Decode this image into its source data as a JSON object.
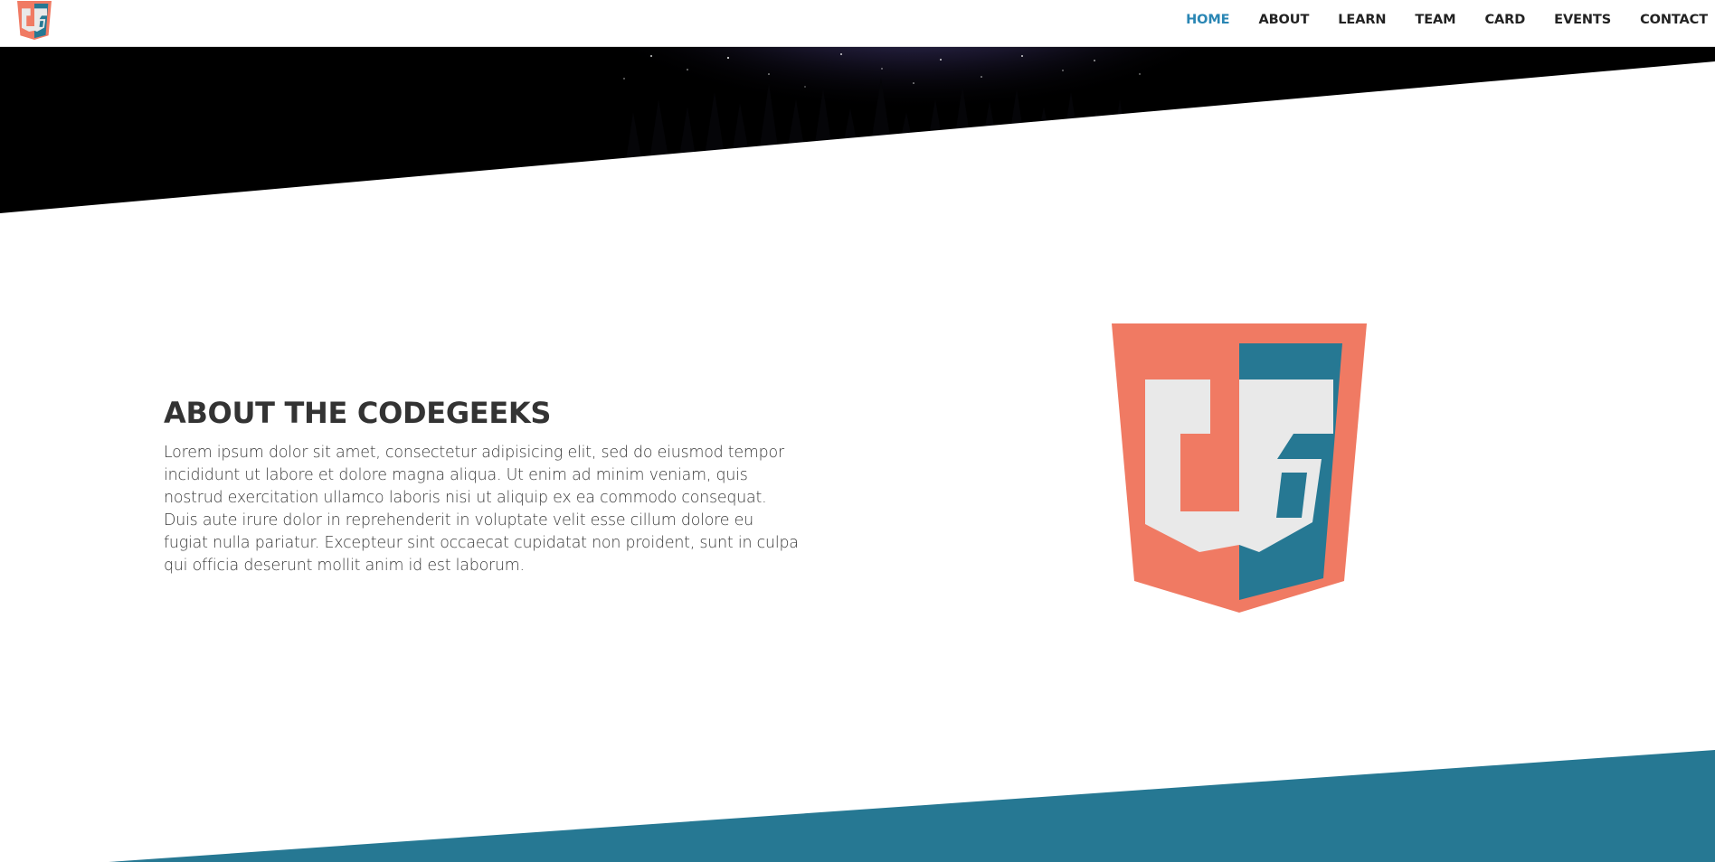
{
  "brand": {
    "logo_alt": "CodeGeeks logo",
    "colors": {
      "coral": "#f07a63",
      "teal": "#267893",
      "light": "#e9e9e9",
      "nav_active": "#2a86b4"
    }
  },
  "nav": {
    "items": [
      {
        "label": "HOME",
        "active": true
      },
      {
        "label": "ABOUT",
        "active": false
      },
      {
        "label": "LEARN",
        "active": false
      },
      {
        "label": "TEAM",
        "active": false
      },
      {
        "label": "CARD",
        "active": false
      },
      {
        "label": "EVENTS",
        "active": false
      },
      {
        "label": "CONTACT",
        "active": false
      }
    ]
  },
  "about": {
    "title": "ABOUT THE CODEGEEKS",
    "body": "Lorem ipsum dolor sit amet, consectetur adipisicing elit, sed do eiusmod tempor incididunt ut labore et dolore magna aliqua. Ut enim ad minim veniam, quis nostrud exercitation ullamco laboris nisi ut aliquip ex ea commodo consequat. Duis aute irure dolor in reprehenderit in voluptate velit esse cillum dolore eu fugiat nulla pariatur. Excepteur sint occaecat cupidatat non proident, sunt in culpa qui officia deserunt mollit anim id est laborum."
  }
}
